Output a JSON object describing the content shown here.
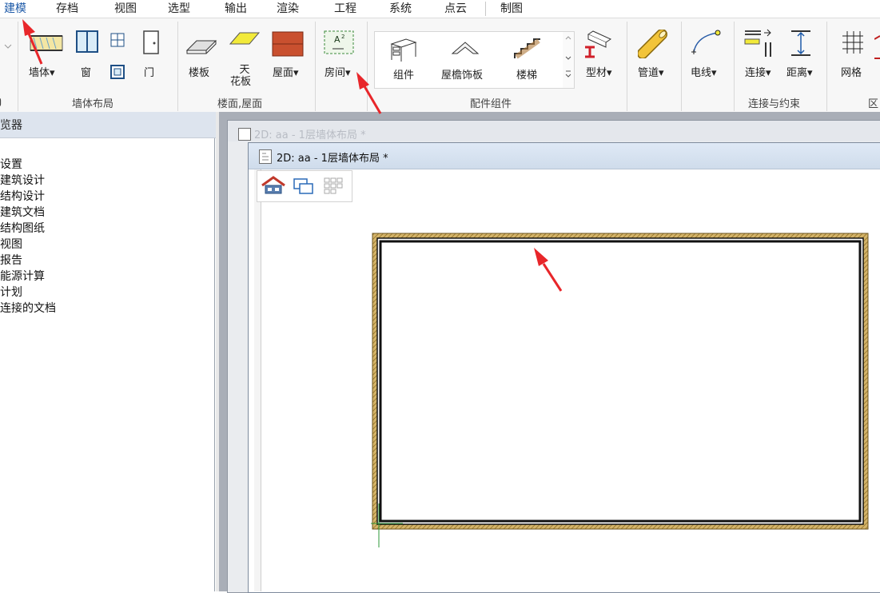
{
  "menu": {
    "tabs": [
      "建模",
      "存档",
      "视图",
      "选型",
      "输出",
      "渲染",
      "工程",
      "系统",
      "点云",
      "制图"
    ],
    "active": "建模"
  },
  "ribbon": {
    "buttons": {
      "wall": "墙体",
      "window": "窗",
      "door": "门",
      "slab": "楼板",
      "ceiling_line1": "天",
      "ceiling_line2": "花板",
      "roof": "屋面",
      "room": "房间",
      "component": "组件",
      "eave": "屋檐饰板",
      "stair": "楼梯",
      "profile": "型材",
      "pipe": "管道",
      "wire": "电线",
      "connect": "连接",
      "distance": "距离",
      "grid": "网格"
    },
    "groups": {
      "partial_left": "ŋ",
      "wall_layout": "墙体布局",
      "floor_roof": "楼面,屋面",
      "parts": "配件组件",
      "connect_constraint": "连接与约束",
      "partial_right": "区"
    }
  },
  "left_panel": {
    "title": "览器",
    "items": [
      "设置",
      "建筑设计",
      "结构设计",
      "建筑文档",
      "结构图纸",
      "视图",
      "报告",
      "能源计算",
      "计划",
      "连接的文档"
    ]
  },
  "windows": {
    "back_title": "2D: aa - 1层墙体布局 *",
    "front_title": "2D: aa - 1层墙体布局 *"
  },
  "colors": {
    "accent": "#1e5aa8",
    "annotation_arrow": "#e8262a",
    "wall_hatch": "#b8934a"
  }
}
